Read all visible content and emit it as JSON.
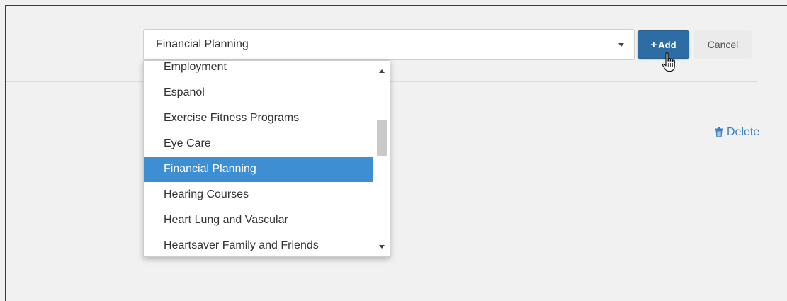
{
  "select": {
    "value": "Financial Planning"
  },
  "buttons": {
    "add_label": "Add",
    "add_symbol": "+",
    "cancel_label": "Cancel"
  },
  "delete": {
    "label": "Delete",
    "icon": "trash-icon"
  },
  "dropdown": {
    "options": [
      "Employment",
      "Espanol",
      "Exercise Fitness Programs",
      "Eye Care",
      "Financial Planning",
      "Hearing Courses",
      "Heart Lung and Vascular",
      "Heartsaver Family and Friends"
    ],
    "selected": "Financial Planning"
  },
  "colors": {
    "primary": "#2e6da4",
    "highlight": "#3d8ed2",
    "link": "#3a80c0"
  }
}
